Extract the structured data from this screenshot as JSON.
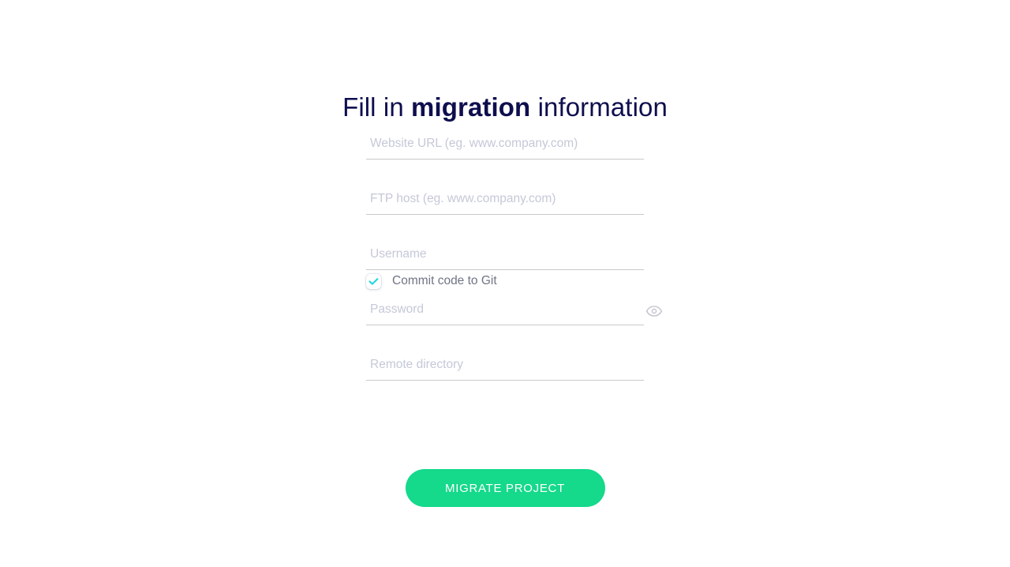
{
  "title": {
    "prefix": "Fill in ",
    "highlight": "migration",
    "suffix": " information",
    "color": "#0e0e4e"
  },
  "form": {
    "fields": [
      {
        "name": "website-url",
        "placeholder": "Website URL (eg. www.company.com)",
        "value": "",
        "type": "text"
      },
      {
        "name": "ftp-host",
        "placeholder": "FTP host (eg. www.company.com)",
        "value": "",
        "type": "text"
      },
      {
        "name": "username",
        "placeholder": "Username",
        "value": "",
        "type": "text"
      },
      {
        "name": "password",
        "placeholder": "Password",
        "value": "",
        "type": "password"
      },
      {
        "name": "remote-directory",
        "placeholder": "Remote directory",
        "value": "",
        "type": "text"
      }
    ],
    "password_toggle_icon": "eye-icon",
    "checkbox": {
      "label": "Commit code to Git",
      "checked": true,
      "check_color": "#1ed5e0",
      "label_color": "#707584"
    },
    "submit": {
      "label": "MIGRATE PROJECT",
      "background": "#15d98b",
      "text_color": "#ffffff"
    }
  },
  "theme": {
    "background": "#ffffff",
    "placeholder_color": "#c5c8d8",
    "underline_color": "#c9c9c9",
    "icon_color": "#c0c2cc"
  }
}
